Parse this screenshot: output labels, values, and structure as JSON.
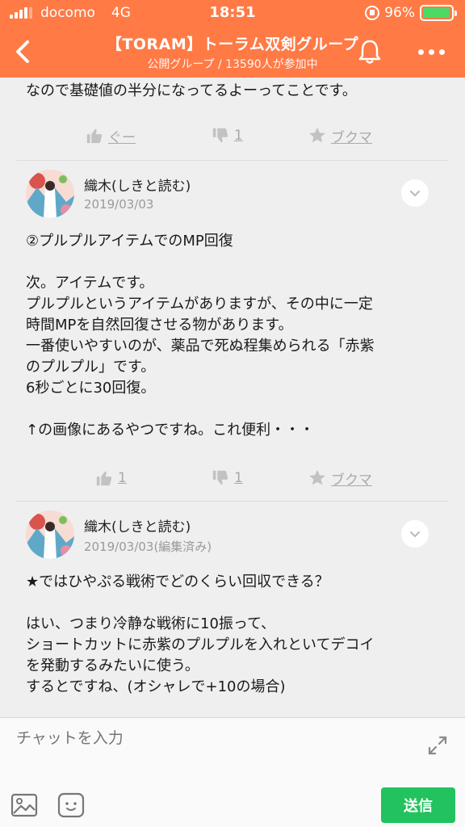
{
  "status_bar": {
    "carrier": "docomo",
    "network": "4G",
    "time": "18:51",
    "battery": "96%",
    "battery_level": 0.96
  },
  "header": {
    "title": "【TORAM】トーラム双剣グループ",
    "subtitle": "公開グループ / 13590人が参加中"
  },
  "posts": [
    {
      "body": [
        "なので基礎値の半分になってるよーってことです。"
      ],
      "actions": {
        "like": "ぐー",
        "dislike": "1",
        "bookmark": "ブクマ"
      }
    },
    {
      "author": "織木(しきと読む)",
      "date": "2019/03/03",
      "body": [
        "②プルプルアイテムでのMP回復",
        "",
        "次。アイテムです。",
        "プルプルというアイテムがありますが、その中に一定",
        "時間MPを自然回復させる物があります。",
        "一番使いやすいのが、薬品で死ぬ程集められる「赤紫",
        "のプルプル」です。",
        "6秒ごとに30回復。",
        "",
        "↑の画像にあるやつですね。これ便利・・・"
      ],
      "actions": {
        "like": "1",
        "dislike": "1",
        "bookmark": "ブクマ"
      }
    },
    {
      "author": "織木(しきと読む)",
      "date": "2019/03/03(編集済み)",
      "body": [
        "★ではひやぷる戦術でどのくらい回収できる？",
        "",
        "はい、つまり冷静な戦術に10振って、",
        "ショートカットに赤紫のプルプルを入れといてデコイ",
        "を発動するみたいに使う。",
        "するとですね、(オシャレで+10の場合)"
      ]
    }
  ],
  "input": {
    "placeholder": "チャットを入力",
    "send_label": "送信"
  },
  "colors": {
    "accent": "#ff7a45",
    "send": "#22c25e"
  }
}
